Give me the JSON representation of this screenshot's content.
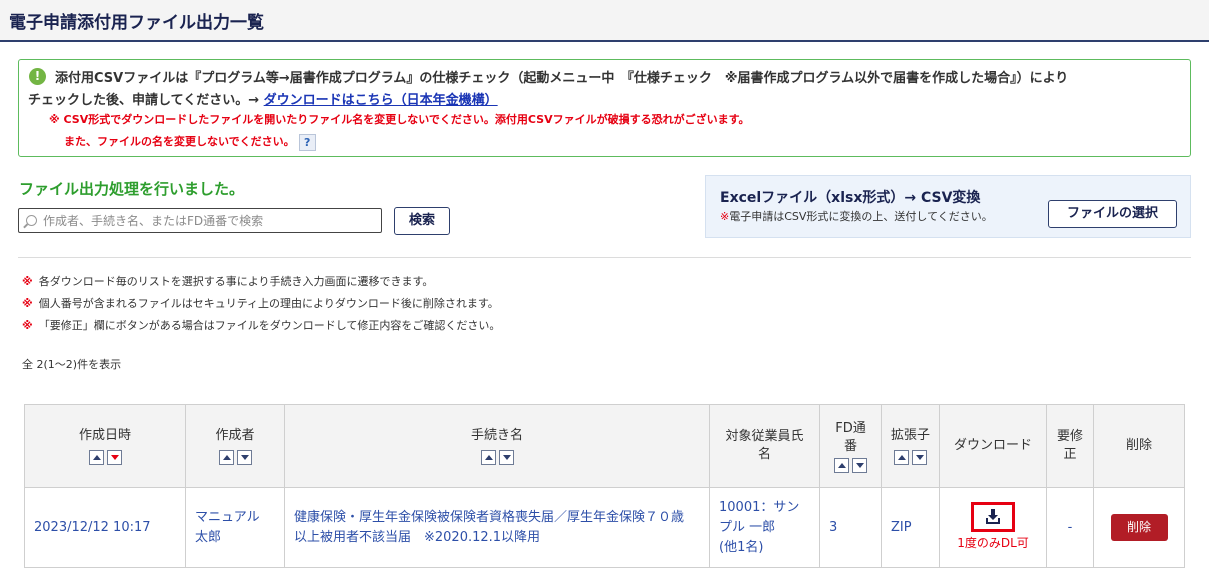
{
  "header": {
    "title": "電子申請添付用ファイル出力一覧"
  },
  "notice": {
    "icon": "exclamation-icon",
    "line1": "添付用CSVファイルは『プログラム等→届書作成プログラム』の仕様チェック（起動メニュー中　『仕様チェック　※届書作成プログラム以外で届書を作成した場合』）により",
    "line2_prefix": "チェックした後、申請してください。→ ",
    "link": "ダウンロードはこちら（日本年金機構）",
    "warning1": "※ CSV形式でダウンロードしたファイルを開いたりファイル名を変更しないでください。添付用CSVファイルが破損する恐れがございます。",
    "warning2": "また、ファイルの名を変更しないでください。",
    "help": "?"
  },
  "status": {
    "message": "ファイル出力処理を行いました。"
  },
  "search": {
    "placeholder": "作成者、手続き名、またはFD通番で検索",
    "value": "",
    "button": "検索"
  },
  "excel": {
    "title": "Excelファイル（xlsx形式）→ CSV変換",
    "note_mark": "※",
    "note": "電子申請はCSV形式に変換の上、送付してください。",
    "button": "ファイルの選択"
  },
  "notes": [
    {
      "mark": "※",
      "text": "各ダウンロード毎のリストを選択する事により手続き入力画面に遷移できます。"
    },
    {
      "mark": "※",
      "text": "個人番号が含まれるファイルはセキュリティ上の理由によりダウンロード後に削除されます。"
    },
    {
      "mark": "※",
      "text": "「要修正」欄にボタンがある場合はファイルをダウンロードして修正内容をご確認ください。"
    }
  ],
  "count": "全 2(1〜2)件を表示",
  "table": {
    "headers": {
      "created_at": "作成日時",
      "author": "作成者",
      "procedure": "手続き名",
      "employee_1": "対象従業員氏",
      "employee_2": "名",
      "fd_1": "FD通",
      "fd_2": "番",
      "extension": "拡張子",
      "download": "ダウンロード",
      "fix_1": "要修",
      "fix_2": "正",
      "delete": "削除"
    },
    "rows": [
      {
        "created_at": "2023/12/12 10:17",
        "author_1": "マニュアル",
        "author_2": "太郎",
        "procedure_1": "健康保険・厚生年金保険被保険者資格喪失届／厚生年金保険７０歳",
        "procedure_2": "以上被用者不該当届　※2020.12.1以降用",
        "employee_1": "10001：サン",
        "employee_2": "プル 一郎",
        "employee_3": "(他1名)",
        "fd_number": "3",
        "extension": "ZIP",
        "download_icon": "download-icon",
        "download_note": "1度のみDL可",
        "fix": "-",
        "delete_label": "削除"
      }
    ]
  },
  "colors": {
    "accent": "#2e3f6d",
    "danger": "#e60012",
    "success": "#2e9e2e",
    "link": "#2d4fa8",
    "delete": "#b21d26"
  }
}
